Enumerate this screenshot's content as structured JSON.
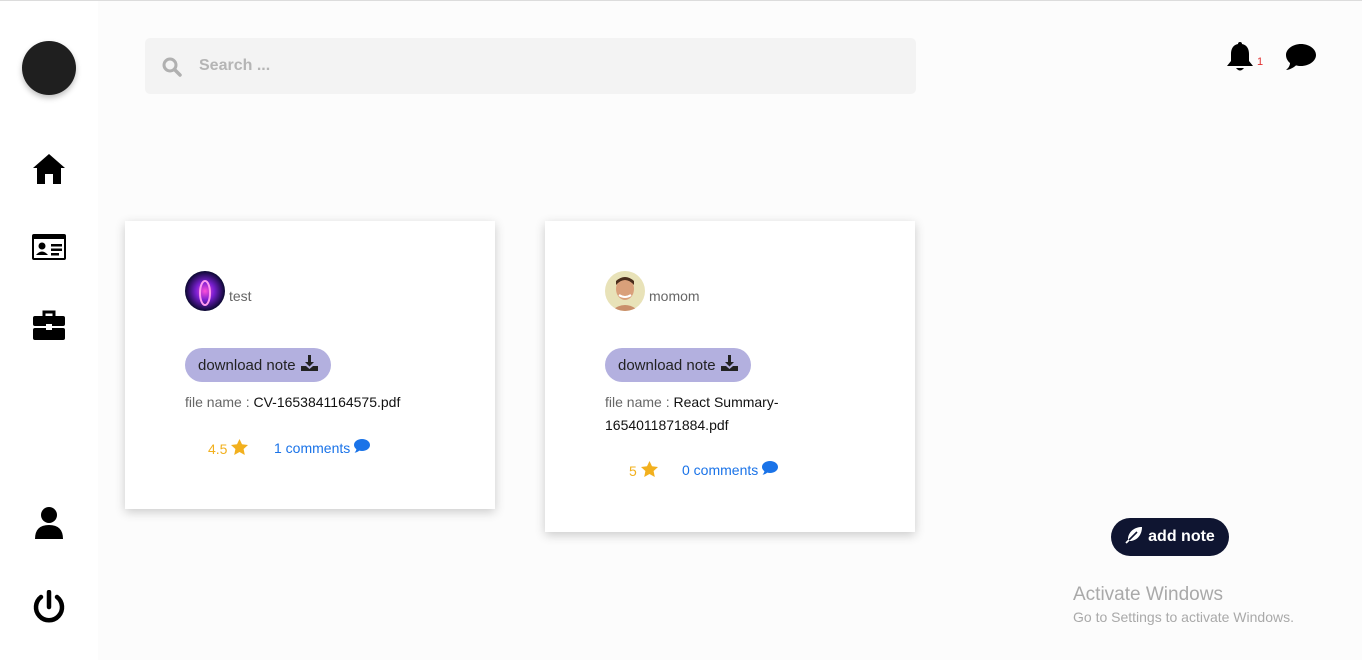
{
  "search": {
    "placeholder": "Search ..."
  },
  "header": {
    "notification_count": "1"
  },
  "sidebar": {
    "items": [
      {
        "name": "home",
        "icon": "home-icon"
      },
      {
        "name": "id-card",
        "icon": "id-card-icon"
      },
      {
        "name": "briefcase",
        "icon": "briefcase-icon"
      },
      {
        "name": "profile",
        "icon": "user-icon"
      },
      {
        "name": "logout",
        "icon": "power-icon"
      }
    ]
  },
  "notes": [
    {
      "username": "test",
      "download_label": "download note",
      "file_label": "file name : ",
      "file_name": "CV-1653841164575.pdf",
      "rating": "4.5",
      "comments": "1 comments"
    },
    {
      "username": "momom",
      "download_label": "download note",
      "file_label": "file name : ",
      "file_name": "React Summary-1654011871884.pdf",
      "rating": "5",
      "comments": "0 comments"
    }
  ],
  "actions": {
    "add_note_label": "add note"
  },
  "watermark": {
    "title": "Activate Windows",
    "subtitle": "Go to Settings to activate Windows."
  },
  "colors": {
    "accent_button": "#b3b0df",
    "add_note_bg": "#0f1531",
    "rating": "#f2b01e",
    "link": "#1a73e8",
    "badge": "#e03030"
  }
}
